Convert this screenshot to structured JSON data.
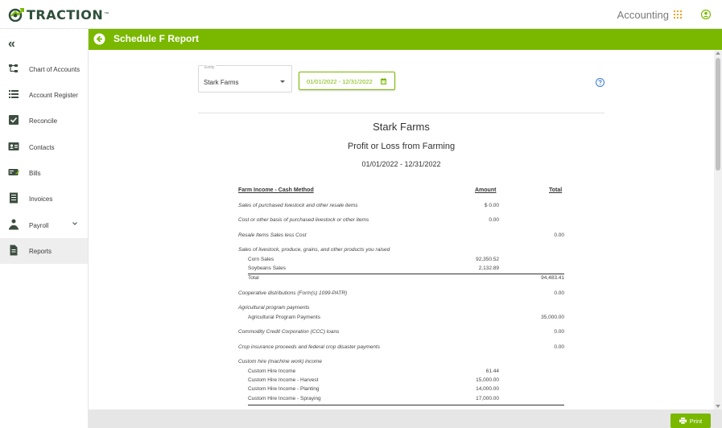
{
  "app": {
    "logo_text": "TRACTION",
    "logo_tm": "™",
    "module_name": "Accounting"
  },
  "sidebar": {
    "items": [
      {
        "label": "Chart of Accounts",
        "icon": "chart-of-accounts-icon"
      },
      {
        "label": "Account Register",
        "icon": "list-icon"
      },
      {
        "label": "Reconcile",
        "icon": "check-square-icon"
      },
      {
        "label": "Contacts",
        "icon": "contact-card-icon"
      },
      {
        "label": "Bills",
        "icon": "bill-icon"
      },
      {
        "label": "Invoices",
        "icon": "invoice-icon"
      },
      {
        "label": "Payroll",
        "icon": "person-money-icon"
      },
      {
        "label": "Reports",
        "icon": "file-icon"
      }
    ],
    "active": "Reports"
  },
  "header": {
    "title": "Schedule F Report"
  },
  "filters": {
    "entity_label": "Entity",
    "entity_value": "Stark Farms",
    "date_range": "01/01/2022 - 12/31/2022"
  },
  "report": {
    "entity": "Stark Farms",
    "title": "Profit or Loss from Farming",
    "date_range": "01/01/2022 - 12/31/2022",
    "section_header": "Farm Income - Cash Method",
    "col_amount": "Amount",
    "col_total": "Total",
    "rows": {
      "purchased_livestock": {
        "label": "Sales of purchased livestock and other resale items",
        "amount": "$ 0.00"
      },
      "cost_basis": {
        "label": "Cost or other basis of purchased livestock or other items",
        "amount": "0.00"
      },
      "resale_less_cost": {
        "label": "Resale Items Sales less Cost",
        "total": "0.00"
      },
      "sales_raised": {
        "label": "Sales of livestock, produce, grains, and other products you raised"
      },
      "corn": {
        "label": "Corn Sales",
        "amount": "92,350.52"
      },
      "soybeans": {
        "label": "Soybeans Sales",
        "amount": "2,132.89"
      },
      "sales_total": {
        "label": "Total",
        "total": "94,483.41"
      },
      "coop": {
        "label": "Cooperative distributions (Form(s) 1099-PATR)",
        "total": "0.00"
      },
      "ag_program": {
        "label": "Agricultural program payments"
      },
      "ag_program_payments": {
        "label": "Agricultural Program Payments",
        "total": "35,000.00"
      },
      "ccc": {
        "label": "Commodity Credit Corporation (CCC) loans",
        "total": "0.00"
      },
      "crop_insurance": {
        "label": "Crop insurance proceeds and federal crop disaster payments",
        "total": "0.00"
      },
      "custom_hire": {
        "label": "Custom hire (machine work) income"
      },
      "custom_hire_income": {
        "label": "Custom Hire Income",
        "amount": "61.44"
      },
      "custom_hire_harvest": {
        "label": "Custom Hire Income - Harvest",
        "amount": "15,000.00"
      },
      "custom_hire_planting": {
        "label": "Custom Hire Income - Planting",
        "amount": "14,000.00"
      },
      "custom_hire_spraying": {
        "label": "Custom Hire Income - Spraying",
        "amount": "17,000.00"
      }
    }
  },
  "footer": {
    "print_label": "Print"
  },
  "colors": {
    "brand_green": "#7ab800",
    "accent_orange": "#f0a020"
  }
}
